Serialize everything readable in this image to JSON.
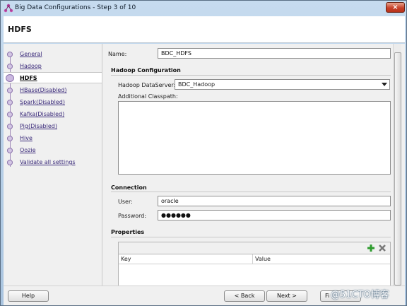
{
  "window": {
    "title": "Big Data Configurations - Step 3 of 10",
    "close_glyph": "×"
  },
  "header": {
    "title": "HDFS"
  },
  "nav": {
    "items": [
      {
        "label": "General",
        "active": false
      },
      {
        "label": "Hadoop",
        "active": false
      },
      {
        "label": "HDFS",
        "active": true
      },
      {
        "label": "HBase(Disabled)",
        "active": false
      },
      {
        "label": "Spark(Disabled)",
        "active": false
      },
      {
        "label": "Kafka(Disabled)",
        "active": false
      },
      {
        "label": "Pig(Disabled)",
        "active": false
      },
      {
        "label": "Hive",
        "active": false
      },
      {
        "label": "Oozie",
        "active": false
      },
      {
        "label": "Validate all settings",
        "active": false
      }
    ]
  },
  "form": {
    "name_label": "Name:",
    "name_value": "BDC_HDFS",
    "hadoop_config_title": "Hadoop Configuration",
    "dataserver_label": "Hadoop DataServer:",
    "dataserver_value": "BDC_Hadoop",
    "classpath_label": "Additional Classpath:",
    "classpath_value": "",
    "connection_title": "Connection",
    "user_label": "User:",
    "user_value": "oracle",
    "password_label": "Password:",
    "password_value": "●●●●●●",
    "properties_title": "Properties",
    "properties_columns": [
      "Key",
      "Value"
    ],
    "add_icon": "plus-icon",
    "remove_icon": "remove-x-icon"
  },
  "footer": {
    "help_label": "Help",
    "back_label": "< Back",
    "next_label": "Next >",
    "finish_label": "Fi"
  },
  "watermark": "@51CTO博客",
  "colors": {
    "title_gradient_top": "#c6dbef",
    "nav_link": "#3a2a7a",
    "nav_dot": "#d3c6e4",
    "add_icon": "#2e9b2e",
    "remove_icon": "#7a7a7a",
    "close_button": "#c7422a"
  }
}
